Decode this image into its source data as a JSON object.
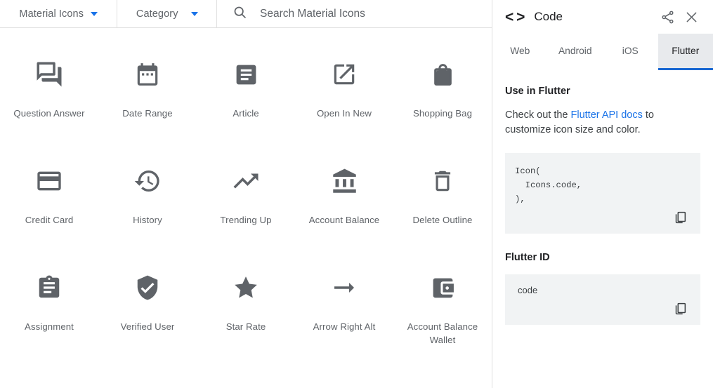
{
  "topbar": {
    "material_dropdown": {
      "label": "Material Icons",
      "icon": "chevron-down-icon"
    },
    "category_dropdown": {
      "label": "Category",
      "icon": "chevron-down-icon"
    },
    "search": {
      "icon": "search-icon",
      "value": "",
      "placeholder": "Search Material Icons"
    }
  },
  "icon_grid": {
    "items": [
      {
        "name": "Question Answer",
        "icon": "question-answer-icon"
      },
      {
        "name": "Date Range",
        "icon": "date-range-icon"
      },
      {
        "name": "Article",
        "icon": "article-icon"
      },
      {
        "name": "Open In New",
        "icon": "open-in-new-icon"
      },
      {
        "name": "Shopping Bag",
        "icon": "shopping-bag-icon"
      },
      {
        "name": "Credit Card",
        "icon": "credit-card-icon"
      },
      {
        "name": "History",
        "icon": "history-icon"
      },
      {
        "name": "Trending Up",
        "icon": "trending-up-icon"
      },
      {
        "name": "Account Balance",
        "icon": "account-balance-icon"
      },
      {
        "name": "Delete Outline",
        "icon": "delete-outline-icon"
      },
      {
        "name": "Assignment",
        "icon": "assignment-icon"
      },
      {
        "name": "Verified User",
        "icon": "verified-user-icon"
      },
      {
        "name": "Star Rate",
        "icon": "star-rate-icon"
      },
      {
        "name": "Arrow Right Alt",
        "icon": "arrow-right-alt-icon"
      },
      {
        "name": "Account Balance Wallet",
        "icon": "account-balance-wallet-icon"
      }
    ]
  },
  "panel": {
    "code_glyph": "< >",
    "title": "Code",
    "share_icon": "share-icon",
    "close_icon": "close-icon",
    "tabs": [
      {
        "label": "Web",
        "active": false
      },
      {
        "label": "Android",
        "active": false
      },
      {
        "label": "iOS",
        "active": false
      },
      {
        "label": "Flutter",
        "active": true
      }
    ],
    "section_heading": "Use in Flutter",
    "description_prefix": "Check out the ",
    "description_link": "Flutter API docs",
    "description_suffix": " to customize icon size and color.",
    "code_snippet": "Icon(\n  Icons.code,\n),",
    "copy_code_icon": "copy-icon",
    "id_heading": "Flutter ID",
    "id_value": "code",
    "copy_id_icon": "copy-icon"
  },
  "colors": {
    "accent_blue": "#1a73e8",
    "tab_underline": "#1967d2",
    "icon_grey": "#5f6368",
    "code_bg": "#f1f3f4",
    "active_tab_bg": "#e8eaed"
  }
}
